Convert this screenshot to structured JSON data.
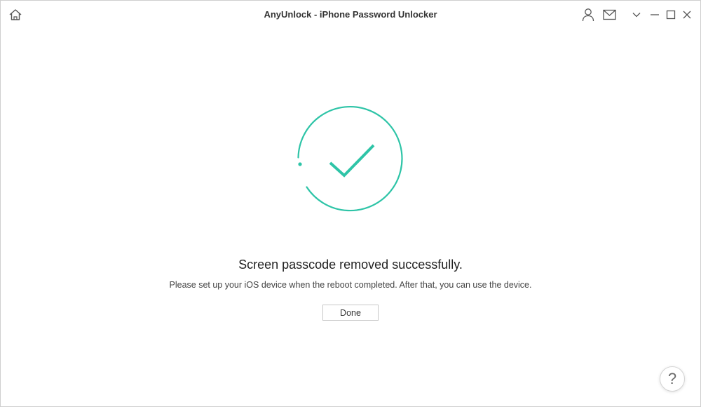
{
  "window": {
    "title": "AnyUnlock - iPhone Password Unlocker"
  },
  "titlebar_icons": {
    "home": "home-icon",
    "user": "user-icon",
    "mail": "mail-icon",
    "menu": "chevron-down-icon",
    "minimize": "minimize-icon",
    "maximize": "maximize-icon",
    "close": "close-icon"
  },
  "result": {
    "icon": "checkmark-icon",
    "headline": "Screen passcode removed successfully.",
    "message": "Please set up your iOS device when the reboot completed. After that, you can use the device.",
    "done_label": "Done"
  },
  "help": {
    "label": "?"
  },
  "colors": {
    "accent": "#2ec4a7",
    "border": "#cfcfcf",
    "text": "#222222",
    "icon": "#555555"
  }
}
